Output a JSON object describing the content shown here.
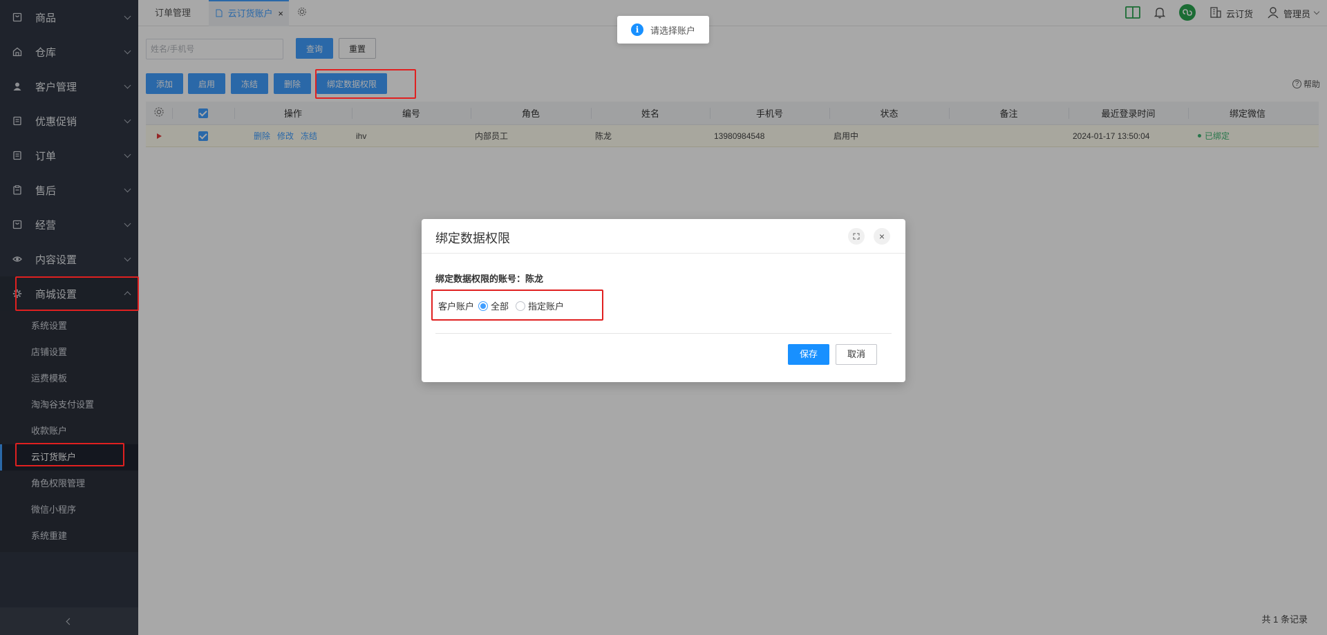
{
  "sidebar": {
    "menu": [
      {
        "label": "商品",
        "icon": "bag-icon"
      },
      {
        "label": "仓库",
        "icon": "warehouse-icon"
      },
      {
        "label": "客户管理",
        "icon": "user-icon"
      },
      {
        "label": "优惠促销",
        "icon": "coupon-icon"
      },
      {
        "label": "订单",
        "icon": "order-icon"
      },
      {
        "label": "售后",
        "icon": "clipboard-icon"
      },
      {
        "label": "经营",
        "icon": "bag-icon"
      },
      {
        "label": "内容设置",
        "icon": "eye-icon"
      },
      {
        "label": "商城设置",
        "icon": "gear-icon"
      }
    ],
    "submenu": [
      {
        "label": "系统设置"
      },
      {
        "label": "店铺设置"
      },
      {
        "label": "运费模板"
      },
      {
        "label": "淘淘谷支付设置"
      },
      {
        "label": "收款账户"
      },
      {
        "label": "云订货账户"
      },
      {
        "label": "角色权限管理"
      },
      {
        "label": "微信小程序"
      },
      {
        "label": "系统重建"
      }
    ]
  },
  "topbar": {
    "tabs": [
      "订单管理",
      "云订货账户"
    ],
    "close_glyph": "×",
    "store_name": "云订货",
    "user_name": "管理员"
  },
  "toolbar": {
    "search_placeholder": "姓名/手机号",
    "query": "查询",
    "reset": "重置",
    "add": "添加",
    "enable": "启用",
    "freeze": "冻结",
    "delete": "删除",
    "bind_permission": "绑定数据权限",
    "help": "帮助"
  },
  "table": {
    "headers": [
      "操作",
      "编号",
      "角色",
      "姓名",
      "手机号",
      "状态",
      "备注",
      "最近登录时间",
      "绑定微信"
    ],
    "rows": [
      {
        "actions": [
          "删除",
          "修改",
          "冻结"
        ],
        "code": "ihv",
        "role": "内部员工",
        "name": "陈龙",
        "phone": "13980984548",
        "status": "启用中",
        "remark": "",
        "last_login": "2024-01-17 13:50:04",
        "wechat": "已绑定"
      }
    ],
    "total": "共 1 条记录"
  },
  "toast": {
    "message": "请选择账户",
    "icon_glyph": "i"
  },
  "dialog": {
    "title": "绑定数据权限",
    "account_line": "绑定数据权限的账号：陈龙",
    "field_label": "客户账户",
    "option_all": "全部",
    "option_specific": "指定账户",
    "selected": "全部",
    "save": "保存",
    "cancel": "取消",
    "close_glyph": "×"
  },
  "colors": {
    "primary": "#409eff",
    "sidebar_bg": "#303643",
    "annotation_red": "#e02020"
  }
}
